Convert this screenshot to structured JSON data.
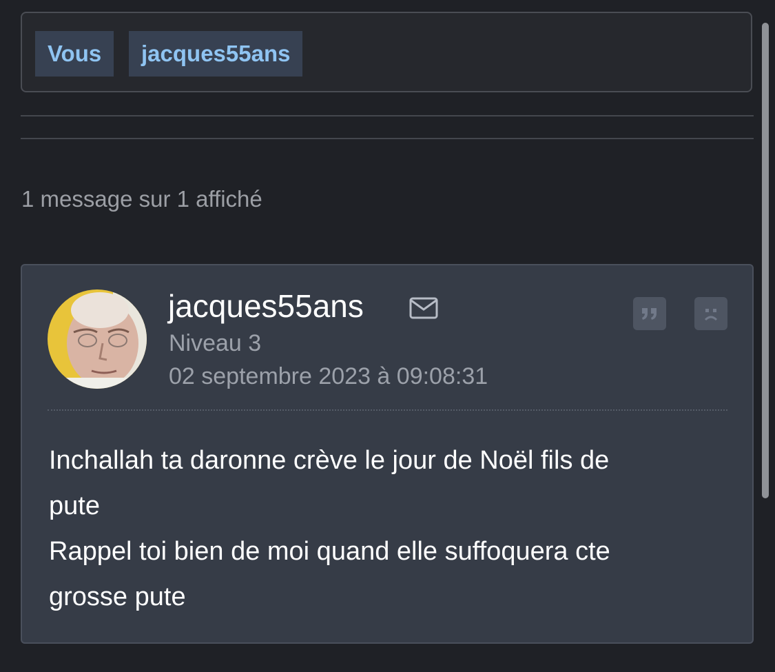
{
  "participants": {
    "chips": [
      "Vous",
      "jacques55ans"
    ]
  },
  "summary": {
    "count_text": "1 message sur 1 affiché"
  },
  "message": {
    "author": "jacques55ans",
    "level": "Niveau 3",
    "date": "02 septembre 2023 à 09:08:31",
    "icons": {
      "mail": "mail-icon",
      "quote": "quote-icon",
      "report": "sad-face-icon"
    },
    "lines": [
      "Inchallah ta daronne crève le jour de Noël fils de",
      "pute",
      "Rappel toi bien de moi quand elle suffoquera cte",
      "grosse pute"
    ]
  },
  "colors": {
    "background": "#1f2126",
    "card": "#363c47",
    "chip_background": "#374152",
    "chip_text": "#8fc4f2"
  }
}
